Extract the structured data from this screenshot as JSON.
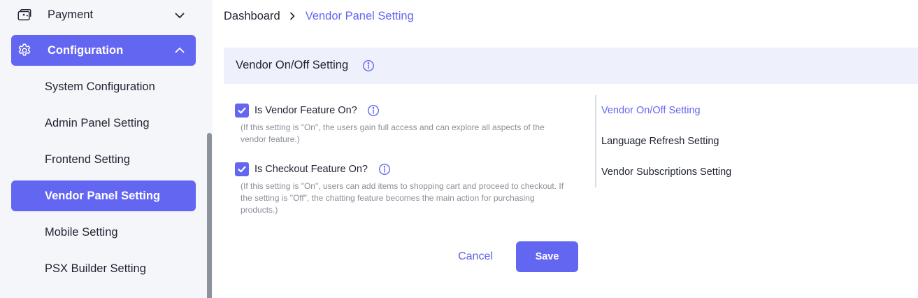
{
  "sidebar": {
    "payment": {
      "label": "Payment",
      "icon": "payment-icon"
    },
    "configuration": {
      "label": "Configuration",
      "icon": "gear-icon"
    },
    "items": [
      {
        "label": "System Configuration"
      },
      {
        "label": "Admin Panel Setting"
      },
      {
        "label": "Frontend Setting"
      },
      {
        "label": "Vendor Panel Setting",
        "active": true
      },
      {
        "label": "Mobile Setting"
      },
      {
        "label": "PSX Builder Setting"
      }
    ]
  },
  "breadcrumb": {
    "home": "Dashboard",
    "current": "Vendor Panel Setting"
  },
  "panel": {
    "title": "Vendor On/Off Setting",
    "settings": [
      {
        "label": "Is Vendor Feature On?",
        "checked": true,
        "description": "(If this setting is \"On\", the users gain full access and can explore all aspects of the vendor feature.)"
      },
      {
        "label": "Is Checkout Feature On?",
        "checked": true,
        "description": "(If this setting is \"On\", users can add items to shopping cart and proceed to checkout. If the setting is \"Off\", the chatting feature becomes the main action for purchasing products.)"
      }
    ],
    "cancel_label": "Cancel",
    "save_label": "Save"
  },
  "anchor_nav": [
    {
      "label": "Vendor On/Off Setting",
      "active": true
    },
    {
      "label": "Language Refresh Setting"
    },
    {
      "label": "Vendor Subscriptions Setting"
    }
  ],
  "colors": {
    "accent": "#6366f1",
    "sidebar_bg": "#f4f6fa",
    "panel_header_bg": "#eef1fb"
  }
}
